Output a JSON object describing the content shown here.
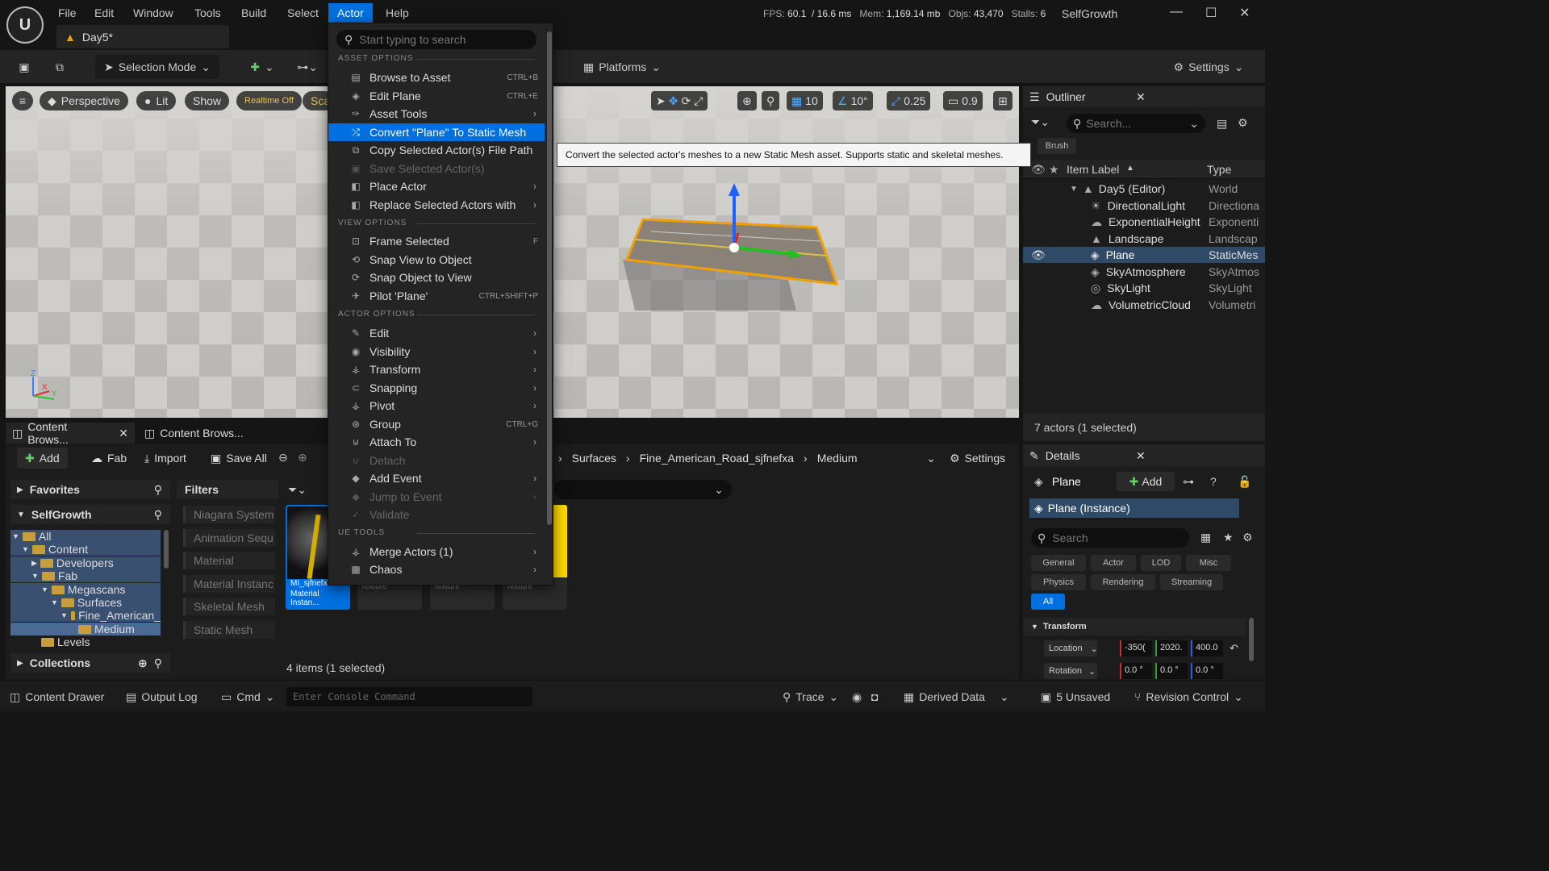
{
  "app": {
    "project": "SelfGrowth",
    "document_tab": "Day5*"
  },
  "menubar": [
    "File",
    "Edit",
    "Window",
    "Tools",
    "Build",
    "Select",
    "Actor",
    "Help"
  ],
  "stats": {
    "fps_label": "FPS:",
    "fps": "60.1",
    "ms": "/ 16.6 ms",
    "mem_label": "Mem:",
    "mem": "1,169.14 mb",
    "objs_label": "Objs:",
    "objs": "43,470",
    "stalls_label": "Stalls:",
    "stalls": "6"
  },
  "toolbar": {
    "selection_mode": "Selection Mode",
    "platforms": "Platforms",
    "settings": "Settings"
  },
  "viewport": {
    "perspective": "Perspective",
    "lit": "Lit",
    "show": "Show",
    "realtime": "Realtime Off",
    "scale": "Sca",
    "grid": "10",
    "angle": "10°",
    "scale_snap": "0.25",
    "camera_speed": "0.9",
    "axis_z": "Z",
    "axis_x": "X",
    "axis_y": "Y"
  },
  "actor_menu": {
    "search_placeholder": "Start typing to search",
    "sections": {
      "asset": "ASSET OPTIONS",
      "view": "VIEW OPTIONS",
      "actor": "ACTOR OPTIONS",
      "ue": "UE TOOLS"
    },
    "items": [
      {
        "label": "Browse to Asset",
        "shortcut": "CTRL+B"
      },
      {
        "label": "Edit Plane",
        "shortcut": "CTRL+E"
      },
      {
        "label": "Asset Tools",
        "shortcut": ""
      },
      {
        "label": "Convert \"Plane\" To Static Mesh",
        "shortcut": ""
      },
      {
        "label": "Copy Selected Actor(s) File Path",
        "shortcut": ""
      },
      {
        "label": "Save Selected Actor(s)",
        "shortcut": ""
      },
      {
        "label": "Place Actor",
        "shortcut": ""
      },
      {
        "label": "Replace Selected Actors with",
        "shortcut": ""
      },
      {
        "label": "Frame Selected",
        "shortcut": "F"
      },
      {
        "label": "Snap View to Object",
        "shortcut": ""
      },
      {
        "label": "Snap Object to View",
        "shortcut": ""
      },
      {
        "label": "Pilot 'Plane'",
        "shortcut": "CTRL+SHIFT+P"
      },
      {
        "label": "Edit",
        "shortcut": ""
      },
      {
        "label": "Visibility",
        "shortcut": ""
      },
      {
        "label": "Transform",
        "shortcut": ""
      },
      {
        "label": "Snapping",
        "shortcut": ""
      },
      {
        "label": "Pivot",
        "shortcut": ""
      },
      {
        "label": "Group",
        "shortcut": "CTRL+G"
      },
      {
        "label": "Attach To",
        "shortcut": ""
      },
      {
        "label": "Detach",
        "shortcut": ""
      },
      {
        "label": "Add Event",
        "shortcut": ""
      },
      {
        "label": "Jump to Event",
        "shortcut": ""
      },
      {
        "label": "Validate",
        "shortcut": ""
      },
      {
        "label": "Merge Actors (1)",
        "shortcut": ""
      },
      {
        "label": "Chaos",
        "shortcut": ""
      }
    ]
  },
  "tooltip": "Convert the selected actor's meshes to a new Static Mesh asset. Supports static and skeletal meshes.",
  "outliner": {
    "title": "Outliner",
    "search_placeholder": "Search...",
    "brush": "Brush",
    "col_label": "Item Label",
    "col_type": "Type",
    "rows": [
      {
        "label": "Day5 (Editor)",
        "type": "World"
      },
      {
        "label": "DirectionalLight",
        "type": "Directiona"
      },
      {
        "label": "ExponentialHeight",
        "type": "Exponenti"
      },
      {
        "label": "Landscape",
        "type": "Landscap"
      },
      {
        "label": "Plane",
        "type": "StaticMes"
      },
      {
        "label": "SkyAtmosphere",
        "type": "SkyAtmos"
      },
      {
        "label": "SkyLight",
        "type": "SkyLight"
      },
      {
        "label": "VolumetricCloud",
        "type": "Volumetri"
      }
    ],
    "footer": "7 actors (1 selected)"
  },
  "details": {
    "title": "Details",
    "object": "Plane",
    "add": "Add",
    "instance": "Plane (Instance)",
    "search_placeholder": "Search",
    "chips": [
      "General",
      "Actor",
      "LOD",
      "Misc",
      "Physics",
      "Rendering",
      "Streaming",
      "All"
    ],
    "section": "Transform",
    "location_label": "Location",
    "location": [
      "-350(",
      "2020.",
      "400.0"
    ],
    "rotation_label": "Rotation",
    "rotation": [
      "0.0 °",
      "0.0 °",
      "0.0 °"
    ]
  },
  "content": {
    "tabs": [
      "Content Brows...",
      "Content Brows..."
    ],
    "add": "Add",
    "fab": "Fab",
    "import": "Import",
    "save_all": "Save All",
    "breadcrumb": [
      "Surfaces",
      "Fine_American_Road_sjfnefxa",
      "Medium"
    ],
    "settings": "Settings",
    "favorites": "Favorites",
    "project": "SelfGrowth",
    "collections": "Collections",
    "filters": "Filters",
    "tree": [
      "All",
      "Content",
      "Developers",
      "Fab",
      "Megascans",
      "Surfaces",
      "Fine_American_",
      "Medium",
      "Levels"
    ],
    "filter_items": [
      "Niagara System",
      "Animation Sequ",
      "Material",
      "Material Instanc",
      "Skeletal Mesh",
      "Static Mesh"
    ],
    "assets": [
      {
        "name": "MI_sjfnefx",
        "type": "Material Instan..."
      },
      {
        "name": "",
        "type": "Texture"
      },
      {
        "name": "",
        "type": "Texture"
      },
      {
        "name": "",
        "type": "Texture"
      }
    ],
    "footer": "4 items (1 selected)"
  },
  "statusbar": {
    "drawer": "Content Drawer",
    "output": "Output Log",
    "cmd": "Cmd",
    "console_placeholder": "Enter Console Command",
    "trace": "Trace",
    "derived": "Derived Data",
    "unsaved": "5 Unsaved",
    "revision": "Revision Control"
  }
}
